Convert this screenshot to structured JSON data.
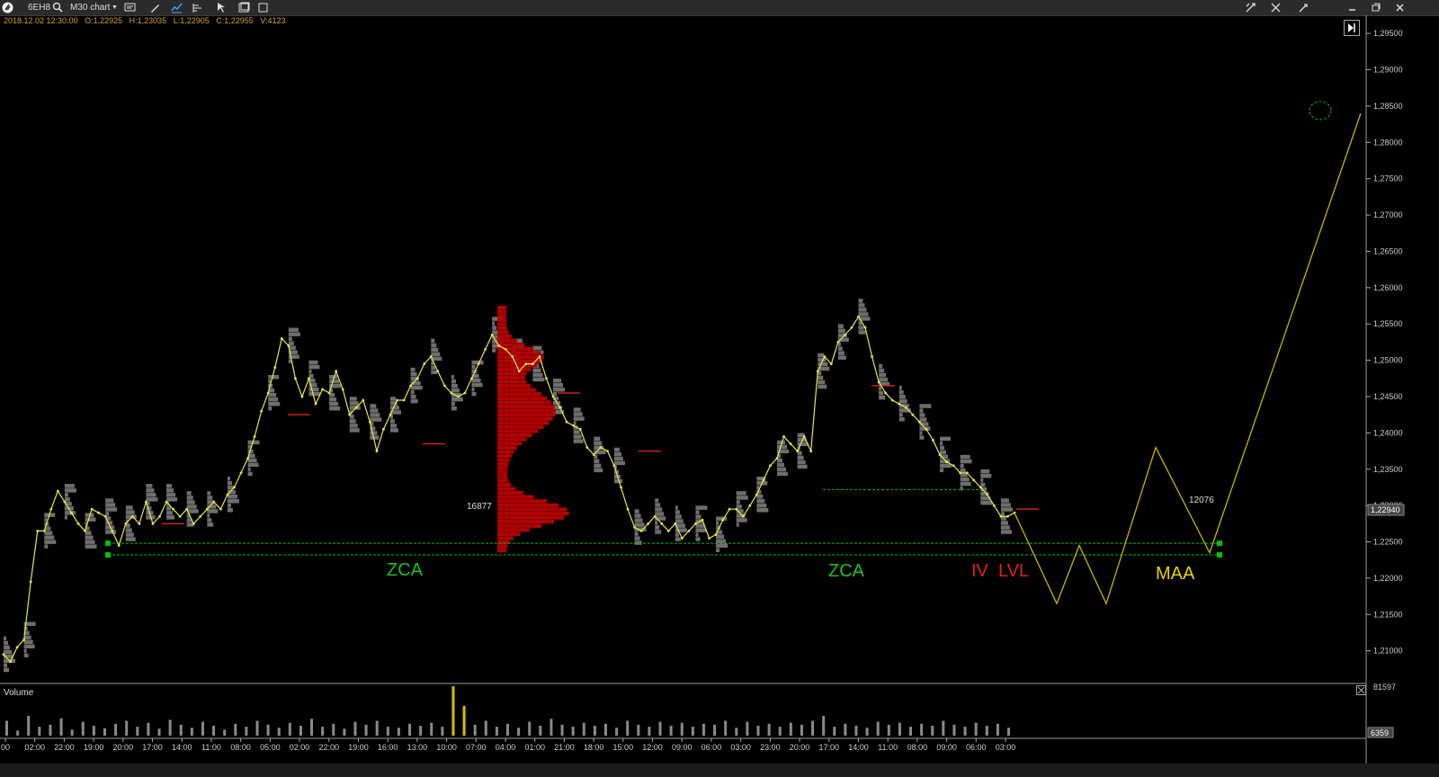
{
  "toolbar": {
    "symbol": "6EH8",
    "timeframe": "M30 chart",
    "icons": [
      "app-logo-icon",
      "search-icon",
      "template-icon",
      "drawing-icon",
      "chart-type-icon",
      "indicators-icon",
      "cursor-icon",
      "layout-icon",
      "save-icon",
      "settings-icon",
      "crosshair-icon",
      "link-icon",
      "minimize-icon",
      "maximize-icon",
      "close-icon"
    ]
  },
  "ohlc": {
    "date": "2018.12.02 12:30:00",
    "open": "O:1,22925",
    "high": "H:1,23035",
    "low": "L:1,22905",
    "close": "C:1,22955",
    "volume": "V:4123"
  },
  "colors": {
    "price_line": "#e6e64c",
    "profile": "#8a8a8a",
    "big_profile": "#b00000",
    "poc": "#cc2222",
    "zone_line": "#00c000",
    "scenario": "#c8b400",
    "zca_label": "#20c020",
    "iv_label": "#e02020",
    "maa_label": "#e6d400"
  },
  "chart_data": {
    "type": "line",
    "title": "",
    "xlabel": "",
    "ylabel": "",
    "ylim": [
      1.2055,
      1.2975
    ],
    "y_ticks": [
      "1,29500",
      "1,29000",
      "1,28500",
      "1,28000",
      "1,27500",
      "1,27000",
      "1,26500",
      "1,26000",
      "1,25500",
      "1,25000",
      "1,24500",
      "1,24000",
      "1,23500",
      "1,23000",
      "1,22500",
      "1,22000",
      "1,21500",
      "1,21000"
    ],
    "y_tick_values": [
      1.295,
      1.29,
      1.285,
      1.28,
      1.275,
      1.27,
      1.265,
      1.26,
      1.255,
      1.25,
      1.245,
      1.24,
      1.235,
      1.23,
      1.225,
      1.22,
      1.215,
      1.21
    ],
    "x_ticks": [
      "00",
      "02:00",
      "22:00",
      "19:00",
      "20:00",
      "17:00",
      "14:00",
      "11:00",
      "08:00",
      "05:00",
      "02:00",
      "22:00",
      "19:00",
      "16:00",
      "13:00",
      "10:00",
      "07:00",
      "04:00",
      "01:00",
      "21:00",
      "18:00",
      "15:00",
      "12:00",
      "09:00",
      "06:00",
      "03:00",
      "23:00",
      "20:00",
      "17:00",
      "14:00",
      "11:00",
      "08:00",
      "09:00",
      "06:00",
      "03:00"
    ],
    "price_label": "1,22940",
    "price_label_value": 1.2294,
    "series": [
      {
        "values": [
          1.2095,
          1.2085,
          1.2105,
          1.2115,
          1.2195,
          1.2265,
          1.2265,
          1.2295,
          1.232,
          1.2305,
          1.229,
          1.2275,
          1.2265,
          1.2295,
          1.229,
          1.2285,
          1.2265,
          1.2245,
          1.2275,
          1.2285,
          1.2275,
          1.2305,
          1.2275,
          1.2285,
          1.2305,
          1.2295,
          1.2285,
          1.2295,
          1.2275,
          1.2285,
          1.2295,
          1.2305,
          1.2295,
          1.2315,
          1.2325,
          1.2345,
          1.2365,
          1.2395,
          1.243,
          1.2455,
          1.249,
          1.253,
          1.252,
          1.2475,
          1.245,
          1.2475,
          1.244,
          1.246,
          1.2455,
          1.2485,
          1.246,
          1.2425,
          1.2435,
          1.2445,
          1.2415,
          1.2375,
          1.2405,
          1.2425,
          1.2445,
          1.2445,
          1.2465,
          1.2475,
          1.2495,
          1.2505,
          1.2485,
          1.2465,
          1.2455,
          1.245,
          1.2455,
          1.2475,
          1.2495,
          1.2515,
          1.2535,
          1.252,
          1.2515,
          1.2505,
          1.2485,
          1.2495,
          1.2495,
          1.2505,
          1.2475,
          1.245,
          1.2435,
          1.2415,
          1.241,
          1.2405,
          1.238,
          1.237,
          1.238,
          1.2375,
          1.2355,
          1.2325,
          1.2295,
          1.227,
          1.2265,
          1.2275,
          1.2285,
          1.2275,
          1.2265,
          1.2275,
          1.2255,
          1.2265,
          1.2275,
          1.228,
          1.2255,
          1.226,
          1.228,
          1.2295,
          1.2295,
          1.2285,
          1.23,
          1.2315,
          1.2335,
          1.2355,
          1.2365,
          1.2395,
          1.2385,
          1.2375,
          1.2395,
          1.2375,
          1.2485,
          1.2505,
          1.2495,
          1.2525,
          1.2535,
          1.2545,
          1.256,
          1.2545,
          1.2505,
          1.247,
          1.2455,
          1.2445,
          1.244,
          1.2435,
          1.2425,
          1.2415,
          1.2405,
          1.239,
          1.237,
          1.236,
          1.2355,
          1.2345,
          1.2345,
          1.2335,
          1.2325,
          1.2315,
          1.23,
          1.2285,
          1.2285,
          1.229
        ]
      },
      {
        "name": "projection",
        "values": [
          1.229,
          1.2165,
          1.2245,
          1.2165,
          1.238,
          1.2235,
          1.284
        ]
      }
    ],
    "volume": {
      "label": "Volume",
      "axis_labels": [
        "81597",
        "6359"
      ],
      "values": [
        30,
        10,
        40,
        18,
        22,
        35,
        12,
        28,
        20,
        15,
        24,
        30,
        18,
        26,
        14,
        32,
        22,
        16,
        28,
        20,
        12,
        24,
        18,
        30,
        22,
        16,
        26,
        20,
        34,
        18,
        24,
        14,
        28,
        22,
        30,
        18,
        16,
        24,
        20,
        26,
        18,
        100,
        60,
        22,
        30,
        18,
        24,
        16,
        28,
        20,
        34,
        22,
        18,
        26,
        20,
        24,
        16,
        30,
        22,
        18,
        28,
        20,
        26,
        18,
        24,
        22,
        30,
        16,
        28,
        20,
        24,
        18,
        26,
        22,
        30,
        40,
        18,
        24,
        20,
        16,
        28,
        22,
        26,
        18,
        24,
        20,
        30,
        22,
        18,
        26,
        20,
        24,
        16
      ]
    },
    "profiles": {
      "big_profile_label": "16877",
      "right_label": "12076"
    },
    "zones": [
      {
        "name": "upper",
        "value": 1.2248
      },
      {
        "name": "lower",
        "value": 1.2232
      },
      {
        "name": "mid",
        "value": 1.2322
      }
    ],
    "annotations": [
      "ZCA",
      "ZCA",
      "IV",
      "LVL",
      "MAA"
    ]
  }
}
